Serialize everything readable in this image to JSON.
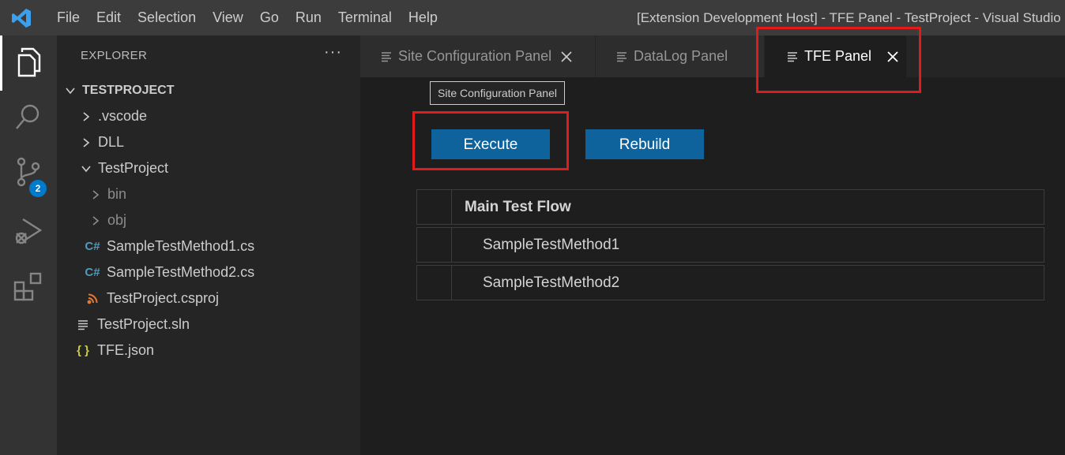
{
  "menu": [
    "File",
    "Edit",
    "Selection",
    "View",
    "Go",
    "Run",
    "Terminal",
    "Help"
  ],
  "window_title": "[Extension Development Host] - TFE Panel - TestProject - Visual Studio",
  "activity": {
    "scm_badge": "2"
  },
  "explorer": {
    "header": "EXPLORER",
    "more": "···",
    "project": "TESTPROJECT",
    "items": [
      {
        "label": ".vscode",
        "icon": "chevron-right-icon"
      },
      {
        "label": "DLL",
        "icon": "chevron-right-icon"
      },
      {
        "label": "TestProject",
        "icon": "chevron-down-icon"
      },
      {
        "label": "bin",
        "icon": "chevron-right-icon"
      },
      {
        "label": "obj",
        "icon": "chevron-right-icon"
      },
      {
        "label": "SampleTestMethod1.cs",
        "icon": "csharp-icon"
      },
      {
        "label": "SampleTestMethod2.cs",
        "icon": "csharp-icon"
      },
      {
        "label": "TestProject.csproj",
        "icon": "rss-icon"
      },
      {
        "label": "TestProject.sln",
        "icon": "lines-icon"
      },
      {
        "label": "TFE.json",
        "icon": "json-braces-icon"
      }
    ]
  },
  "tabs": [
    {
      "label": "Site Configuration Panel",
      "active": false
    },
    {
      "label": "DataLog Panel",
      "active": false
    },
    {
      "label": "TFE Panel",
      "active": true
    }
  ],
  "tooltip": "Site Configuration Panel",
  "buttons": {
    "execute": "Execute",
    "rebuild": "Rebuild"
  },
  "flow": {
    "header": "Main Test Flow",
    "items": [
      "SampleTestMethod1",
      "SampleTestMethod2"
    ]
  },
  "colors": {
    "highlight": "#e31a1a",
    "button": "#0e639c",
    "badge": "#007acc"
  }
}
